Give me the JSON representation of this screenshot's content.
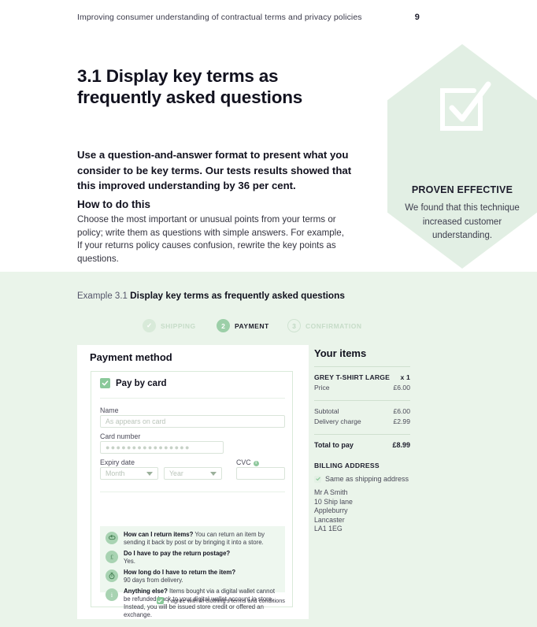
{
  "runhead": {
    "text": "Improving consumer understanding of contractual terms and privacy policies",
    "page_number": "9"
  },
  "section": {
    "title": "3.1 Display key terms as frequently asked questions",
    "lede": "Use a question-and-answer format to present what you consider to be key terms. Our tests results showed that this improved understanding by 36 per cent.",
    "howto_title": "How to do this",
    "howto_body": "Choose the most important or unusual points from your terms or policy; write them as questions with simple answers. For example, If your returns policy causes confusion, rewrite the key points as questions."
  },
  "callout": {
    "title": "PROVEN EFFECTIVE",
    "body": "We found that this technique increased customer understanding.",
    "icon": "checkbox-tick-icon",
    "bg_color": "#e2efe4"
  },
  "example": {
    "label": "Example 3.1",
    "title": "Display key terms as frequently asked questions",
    "band_color": "#eaf4ea"
  },
  "stepper": {
    "steps": [
      {
        "id": "shipping",
        "badge": "✓",
        "label": "SHIPPING",
        "state": "done"
      },
      {
        "id": "payment",
        "badge": "2",
        "label": "PAYMENT",
        "state": "active"
      },
      {
        "id": "confirmation",
        "badge": "3",
        "label": "CONFIRMATION",
        "state": "todo"
      }
    ],
    "active_color": "#9ccfa8",
    "inactive_color": "#d8ead9"
  },
  "payment": {
    "heading": "Payment method",
    "method_label": "Pay by card",
    "method_checked": true,
    "fields": {
      "name_label": "Name",
      "name_placeholder": "As appears on card",
      "card_label": "Card number",
      "card_placeholder": "●●●●●●●●●●●●●●●●",
      "expiry_label": "Expiry date",
      "month_placeholder": "Month",
      "year_placeholder": "Year",
      "cvc_label": "CVC",
      "cvc_value": ""
    },
    "faq": [
      {
        "icon": "return-arrow-icon",
        "question": "How can I return items?",
        "answer": " You can return an item by sending it back by post or by bringing it into a store.",
        "inline": true
      },
      {
        "icon": "pound-sterling-icon",
        "question": "Do I have to pay the return postage?",
        "answer": "Yes.",
        "inline": false
      },
      {
        "icon": "stopwatch-icon",
        "question": "How long do I have to return the item?",
        "answer": "90 days from delivery.",
        "inline": false
      },
      {
        "icon": "info-icon",
        "question": "Anything else?",
        "answer": " Items bought via a digital wallet cannot be refunded back to your digital wallet account in store. Instead, you will be issued store credit or offered an exchange.",
        "inline": true
      }
    ],
    "agree_label": "I agree with M clothing's terms and conditions",
    "agree_checked": true
  },
  "items": {
    "heading": "Your items",
    "product": {
      "name": "GREY T-SHIRT LARGE",
      "qty": "x 1"
    },
    "lines": [
      {
        "label": "Price",
        "value": "£6.00"
      }
    ],
    "totals": [
      {
        "label": "Subtotal",
        "value": "£6.00"
      },
      {
        "label": "Delivery charge",
        "value": "£2.99"
      }
    ],
    "grand_total": {
      "label": "Total to pay",
      "value": "£8.99"
    },
    "billing_heading": "BILLING ADDRESS",
    "same_as_shipping_label": "Same as shipping address",
    "same_as_shipping_checked": true,
    "address": [
      "Mr A Smith",
      "10 Ship lane",
      "Appleburry",
      "Lancaster",
      "LA1 1EG"
    ]
  }
}
